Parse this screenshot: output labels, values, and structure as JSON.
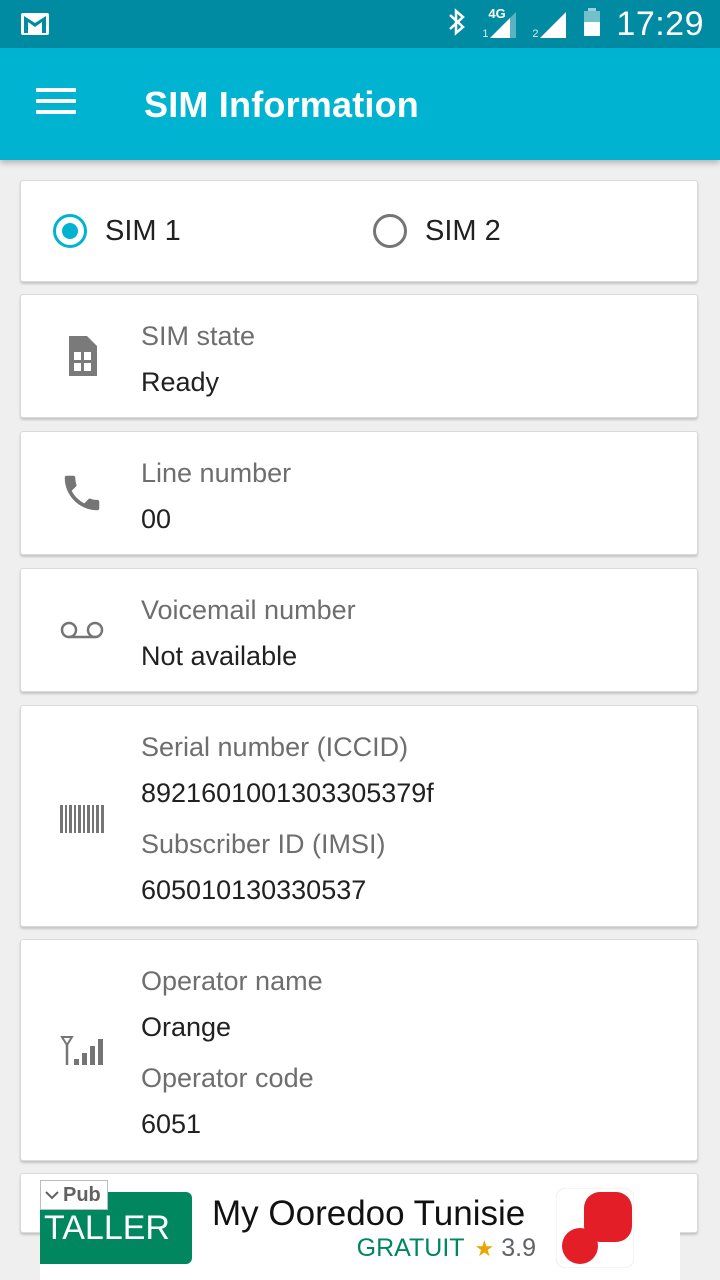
{
  "status_bar": {
    "time": "17:29",
    "icons": [
      "gmail-icon",
      "bluetooth-icon",
      "signal-4g-icon",
      "signal-icon",
      "battery-icon"
    ],
    "network_type": "4G",
    "sim1_index": "1",
    "sim2_index": "2"
  },
  "app_bar": {
    "title": "SIM Information",
    "background": "#00b4d1",
    "status_background": "#008ba3"
  },
  "sim_selector": {
    "options": [
      {
        "label": "SIM 1",
        "checked": true
      },
      {
        "label": "SIM 2",
        "checked": false
      }
    ],
    "accent": "#00b4d1"
  },
  "cards": {
    "sim_state": {
      "icon": "sim-card-icon",
      "label": "SIM state",
      "value": "Ready"
    },
    "line_number": {
      "icon": "phone-icon",
      "label": "Line number",
      "value": "00"
    },
    "voicemail": {
      "icon": "voicemail-icon",
      "label": "Voicemail number",
      "value": "Not available"
    },
    "serial": {
      "icon": "barcode-icon",
      "label": "Serial number (ICCID)",
      "value": "8921601001303305379f",
      "label2": "Subscriber ID (IMSI)",
      "value2": "605010130330537"
    },
    "operator": {
      "icon": "signal-tower-icon",
      "label": "Operator name",
      "value": "Orange",
      "label2": "Operator code",
      "value2": "6051"
    }
  },
  "ad": {
    "tag": "Pub",
    "button_label": "TALLER",
    "app_name": "My Ooredoo Tunisie",
    "price": "GRATUIT",
    "rating": "3.9",
    "button_color": "#01875f",
    "logo_color": "#e41e26"
  }
}
